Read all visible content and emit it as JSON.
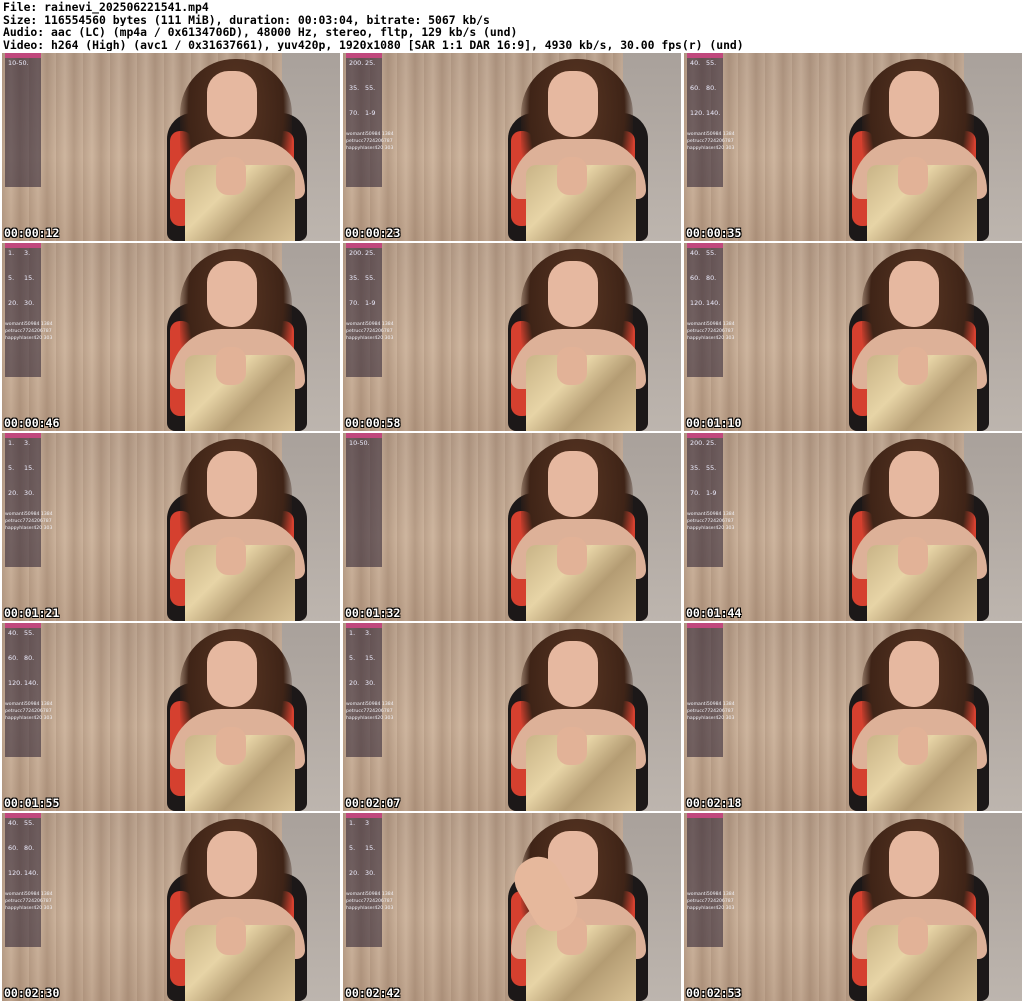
{
  "header": {
    "file": "File: rainevi_202506221541.mp4",
    "size": "Size: 116554560 bytes (111 MiB), duration: 00:03:04, bitrate: 5067 kb/s",
    "audio": "Audio: aac (LC) (mp4a / 0x6134706D), 48000 Hz, stereo, fltp, 129 kb/s (und)",
    "video": "Video: h264 (High) (avc1 / 0x31637661), yuv420p, 1920x1080 [SAR 1:1 DAR 16:9], 4930 kb/s, 30.00 fps(r) (und)"
  },
  "thumbnails": [
    {
      "timestamp": "00:00:12",
      "tips": [
        "10-50."
      ],
      "feed": []
    },
    {
      "timestamp": "00:00:23",
      "tips": [
        "200.",
        "25.",
        "35.",
        "55.",
        "70.",
        "1-9"
      ],
      "feed": [
        "womanti50984  1384",
        "petrucc7724206787",
        "happyhlaser420  303"
      ]
    },
    {
      "timestamp": "00:00:35",
      "tips": [
        "40.",
        "55.",
        "60.",
        "80.",
        "120.",
        "140."
      ],
      "feed": [
        "womanti50984  1384",
        "petrucc7724206787",
        "happyhlaser420  303"
      ]
    },
    {
      "timestamp": "00:00:46",
      "tips": [
        "1.",
        "3.",
        "5.",
        "15.",
        "20.",
        "30."
      ],
      "feed": [
        "womanti50984  1384",
        "petrucc7724206787",
        "happyhlaser420  303"
      ]
    },
    {
      "timestamp": "00:00:58",
      "tips": [
        "200.",
        "25.",
        "35.",
        "55.",
        "70.",
        "1-9"
      ],
      "feed": [
        "womanti50984  1384",
        "petrucc7724206787",
        "happyhlaser420  303"
      ]
    },
    {
      "timestamp": "00:01:10",
      "tips": [
        "40.",
        "55.",
        "60.",
        "80.",
        "120.",
        "140."
      ],
      "feed": [
        "womanti50984  1384",
        "petrucc7724206787",
        "happyhlaser420  303"
      ]
    },
    {
      "timestamp": "00:01:21",
      "tips": [
        "1.",
        "3.",
        "5.",
        "15.",
        "20.",
        "30."
      ],
      "feed": [
        "womanti50984  1384",
        "petrucc7724206787",
        "happyhlaser420  303"
      ]
    },
    {
      "timestamp": "00:01:32",
      "tips": [
        "10-50."
      ],
      "feed": []
    },
    {
      "timestamp": "00:01:44",
      "tips": [
        "200.",
        "25.",
        "35.",
        "55.",
        "70.",
        "1-9"
      ],
      "feed": [
        "womanti50984  1384",
        "petrucc7724206787",
        "happyhlaser420  303"
      ]
    },
    {
      "timestamp": "00:01:55",
      "tips": [
        "40.",
        "55.",
        "60.",
        "80.",
        "120.",
        "140."
      ],
      "feed": [
        "womanti50984  1384",
        "petrucc7724206787",
        "happyhlaser420  303"
      ]
    },
    {
      "timestamp": "00:02:07",
      "tips": [
        "1.",
        "3.",
        "5.",
        "15.",
        "20.",
        "30."
      ],
      "feed": [
        "womanti50984  1384",
        "petrucc7724206787",
        "happyhlaser420  303"
      ]
    },
    {
      "timestamp": "00:02:18",
      "tips": [],
      "feed": [
        "womanti50984  1384",
        "petrucc7724206787",
        "happyhlaser420  303"
      ]
    },
    {
      "timestamp": "00:02:30",
      "tips": [
        "40.",
        "55.",
        "60.",
        "80.",
        "120.",
        "140."
      ],
      "feed": [
        "womanti50984  1384",
        "petrucc7724206787",
        "happyhlaser420  303"
      ]
    },
    {
      "timestamp": "00:02:42",
      "tips": [
        "1.",
        "3",
        "5.",
        "15.",
        "20.",
        "30."
      ],
      "feed": [
        "womanti50984  1384",
        "petrucc7724206787",
        "happyhlaser420  303"
      ]
    },
    {
      "timestamp": "00:02:53",
      "tips": [],
      "feed": [
        "womanti50984  1384",
        "petrucc7724206787",
        "happyhlaser420  303"
      ]
    }
  ]
}
